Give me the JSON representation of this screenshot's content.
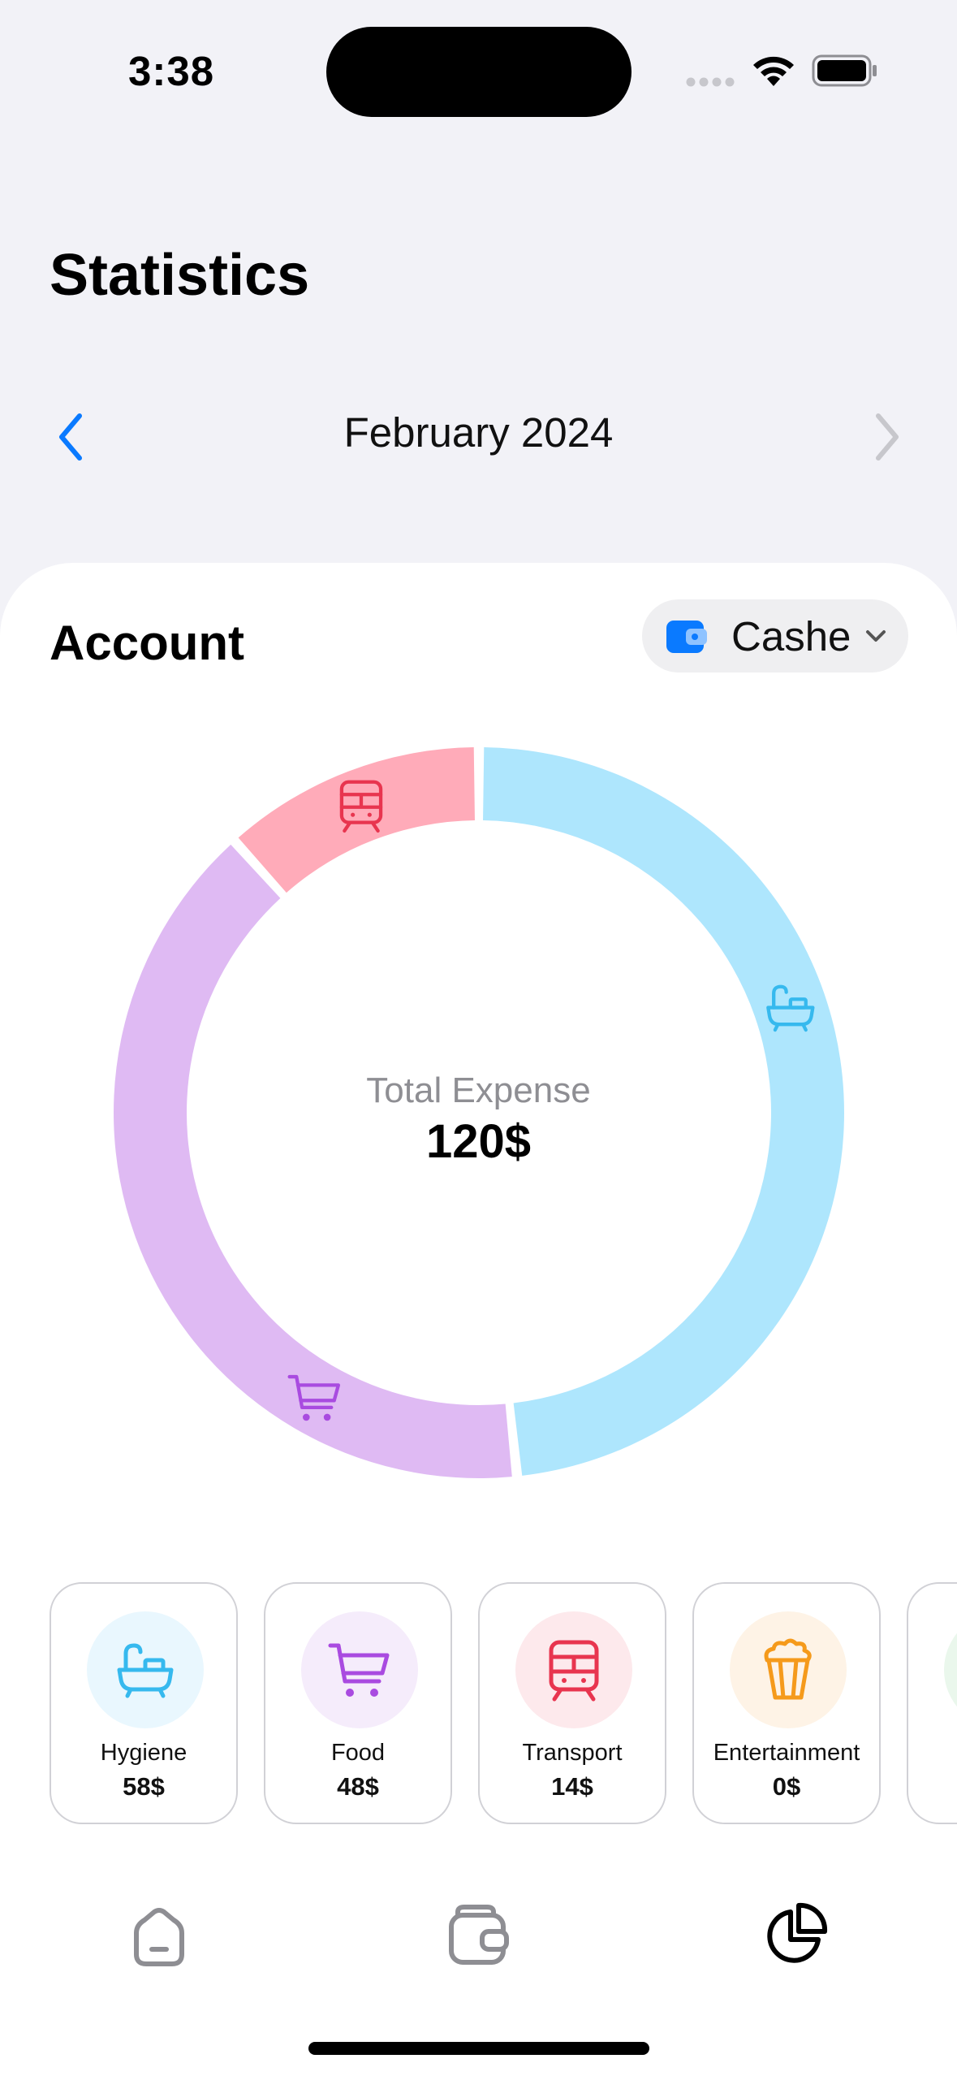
{
  "status_bar": {
    "time": "3:38"
  },
  "header": {
    "title": "Statistics",
    "month": "February 2024"
  },
  "sheet": {
    "title": "Account",
    "account_selector": "Cashe"
  },
  "summary": {
    "label": "Total Expense",
    "total": "120$"
  },
  "chart_data": {
    "type": "pie",
    "categories": [
      "Hygiene",
      "Food",
      "Transport"
    ],
    "values": [
      58,
      48,
      14
    ],
    "colors": [
      "#aee6fd",
      "#dfbaf3",
      "#ffabb9"
    ],
    "icon_colors": [
      "#36b9ee",
      "#a94be0",
      "#e8354f"
    ],
    "icons": [
      "bathtub-icon",
      "shopping-cart-icon",
      "train-icon"
    ]
  },
  "categories": [
    {
      "name": "Hygiene",
      "amount": "58$",
      "icon": "bathtub-icon",
      "bg": "#e9f7fe",
      "color": "#36b9ee"
    },
    {
      "name": "Food",
      "amount": "48$",
      "icon": "shopping-cart-icon",
      "bg": "#f5ecfb",
      "color": "#a94be0"
    },
    {
      "name": "Transport",
      "amount": "14$",
      "icon": "train-icon",
      "bg": "#fde9ec",
      "color": "#e8354f"
    },
    {
      "name": "Entertainment",
      "amount": "0$",
      "icon": "popcorn-icon",
      "bg": "#fef3e6",
      "color": "#f59a1b"
    },
    {
      "name": "",
      "amount": "",
      "icon": "",
      "bg": "#eaf7ec",
      "color": "#34c759"
    }
  ],
  "tab_bar": [
    "home-icon",
    "wallet-icon",
    "pie-chart-icon"
  ],
  "colors": {
    "accent": "#0a7aff",
    "inactive": "#8e8e93"
  }
}
